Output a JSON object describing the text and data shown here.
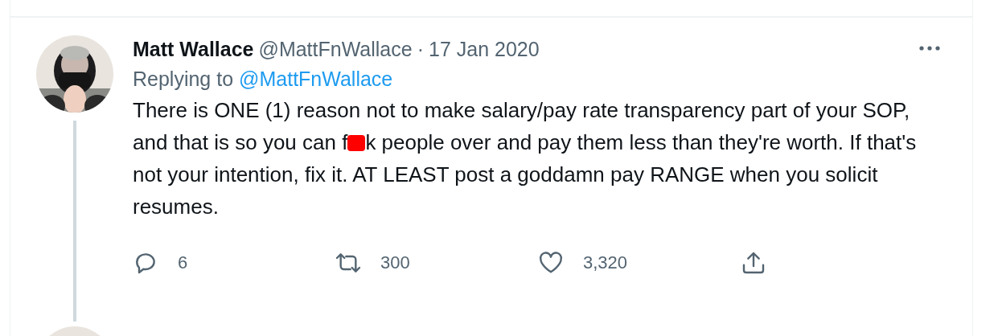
{
  "tweet": {
    "name": "Matt Wallace",
    "handle": "@MattFnWallace",
    "separator": "·",
    "date": "17 Jan 2020",
    "replying_label": "Replying to",
    "replying_handle": "@MattFnWallace",
    "text_before": "There is ONE (1) reason not to make salary/pay rate transparency part of your SOP, and that is so you can f",
    "text_after": "k people over and pay them less than they're worth. If that's not your intention, fix it. AT LEAST post a goddamn pay RANGE when you solicit resumes.",
    "actions": [
      {
        "kind": "reply",
        "count": "6"
      },
      {
        "kind": "retweet",
        "count": "300"
      },
      {
        "kind": "like",
        "count": "3,320"
      },
      {
        "kind": "share"
      }
    ]
  }
}
